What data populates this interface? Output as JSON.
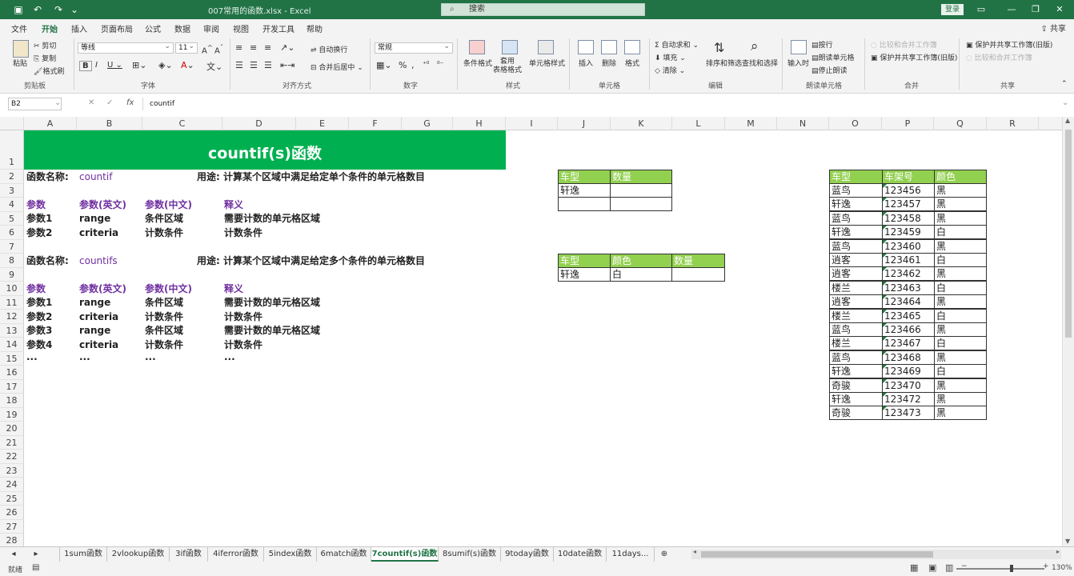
{
  "window": {
    "title": "007常用的函数.xlsx  -  Excel",
    "search_placeholder": "搜索",
    "login": "登录"
  },
  "menu": [
    "文件",
    "开始",
    "插入",
    "页面布局",
    "公式",
    "数据",
    "审阅",
    "视图",
    "开发工具",
    "帮助"
  ],
  "share": "共享",
  "ribbon": {
    "clipboard": {
      "paste": "粘贴",
      "cut": "剪切",
      "copy": "复制",
      "format_painter": "格式刷",
      "label": "剪贴板"
    },
    "font": {
      "name": "等线",
      "size": "11",
      "label": "字体"
    },
    "alignment": {
      "wrap": "自动换行",
      "merge": "合并后居中",
      "label": "对齐方式"
    },
    "number": {
      "format": "常规",
      "label": "数字"
    },
    "styles": {
      "conditional": "条件格式",
      "table1": "套用",
      "table2": "表格格式",
      "cell_styles": "单元格样式",
      "label": "样式"
    },
    "cells": {
      "insert": "插入",
      "delete": "删除",
      "format": "格式",
      "label": "单元格"
    },
    "editing": {
      "autosum": "自动求和",
      "fill": "填充",
      "clear": "清除",
      "sort": "排序和筛选",
      "find": "查找和选择",
      "label": "编辑"
    },
    "read": {
      "input": "输入时",
      "row": "按行",
      "read_cell": "朗读单元格",
      "stop": "停止朗读",
      "label": "朗读单元格"
    },
    "merge_grp": {
      "compare": "比较和合并工作簿",
      "protect_share": "保护并共享工作簿(旧版)",
      "label": "合并"
    },
    "share_grp": {
      "protect": "保护并共享工作簿(旧版)",
      "compare": "比较和合并工作簿",
      "label": "共享"
    }
  },
  "formula_bar": {
    "name_box": "B2",
    "fx": "fx",
    "formula": "countif"
  },
  "columns": [
    "A",
    "B",
    "C",
    "D",
    "E",
    "F",
    "G",
    "H",
    "I",
    "J",
    "K",
    "L",
    "M",
    "N",
    "O",
    "P",
    "Q",
    "R"
  ],
  "rows": [
    "1",
    "2",
    "3",
    "4",
    "5",
    "6",
    "7",
    "8",
    "9",
    "10",
    "11",
    "12",
    "13",
    "14",
    "15",
    "16",
    "17",
    "18",
    "19",
    "20",
    "21",
    "22",
    "23",
    "24",
    "25",
    "26",
    "27",
    "28"
  ],
  "banner": "countif(s)函数",
  "left_cells": {
    "r2": {
      "name_lbl": "函数名称:",
      "name": "countif",
      "usage": "用途: 计算某个区域中满足给定单个条件的单元格数目"
    },
    "r4": {
      "a": "参数",
      "b": "参数(英文)",
      "c": "参数(中文)",
      "d": "释义"
    },
    "r5": {
      "a": "参数1",
      "b": "range",
      "c": "条件区域",
      "d": "需要计数的单元格区域"
    },
    "r6": {
      "a": "参数2",
      "b": "criteria",
      "c": "计数条件",
      "d": "计数条件"
    },
    "r8": {
      "name_lbl": "函数名称:",
      "name": "countifs",
      "usage": "用途: 计算某个区域中满足给定多个条件的单元格数目"
    },
    "r10": {
      "a": "参数",
      "b": "参数(英文)",
      "c": "参数(中文)",
      "d": "释义"
    },
    "r11": {
      "a": "参数1",
      "b": "range",
      "c": "条件区域",
      "d": "需要计数的单元格区域"
    },
    "r12": {
      "a": "参数2",
      "b": "criteria",
      "c": "计数条件",
      "d": "计数条件"
    },
    "r13": {
      "a": "参数3",
      "b": "range",
      "c": "条件区域",
      "d": "需要计数的单元格区域"
    },
    "r14": {
      "a": "参数4",
      "b": "criteria",
      "c": "计数条件",
      "d": "计数条件"
    },
    "r15": {
      "a": "...",
      "b": "...",
      "c": "...",
      "d": "..."
    }
  },
  "table1": {
    "headers": [
      "车型",
      "数量"
    ],
    "rows": [
      [
        "轩逸",
        ""
      ],
      [
        "",
        ""
      ]
    ]
  },
  "table2": {
    "headers": [
      "车型",
      "颜色",
      "数量"
    ],
    "rows": [
      [
        "轩逸",
        "白",
        ""
      ]
    ]
  },
  "table3": {
    "headers": [
      "车型",
      "车架号",
      "颜色"
    ],
    "rows": [
      [
        "蓝鸟",
        "123456",
        "黑"
      ],
      [
        "轩逸",
        "123457",
        "黑"
      ],
      [
        "蓝鸟",
        "123458",
        "黑"
      ],
      [
        "轩逸",
        "123459",
        "白"
      ],
      [
        "蓝鸟",
        "123460",
        "黑"
      ],
      [
        "逍客",
        "123461",
        "白"
      ],
      [
        "逍客",
        "123462",
        "黑"
      ],
      [
        "楼兰",
        "123463",
        "白"
      ],
      [
        "逍客",
        "123464",
        "黑"
      ],
      [
        "楼兰",
        "123465",
        "白"
      ],
      [
        "蓝鸟",
        "123466",
        "黑"
      ],
      [
        "楼兰",
        "123467",
        "白"
      ],
      [
        "蓝鸟",
        "123468",
        "黑"
      ],
      [
        "轩逸",
        "123469",
        "白"
      ],
      [
        "奇骏",
        "123470",
        "黑"
      ],
      [
        "轩逸",
        "123472",
        "黑"
      ],
      [
        "奇骏",
        "123473",
        "黑"
      ]
    ]
  },
  "tabs": [
    "1sum函数",
    "2vlookup函数",
    "3if函数",
    "4iferror函数",
    "5index函数",
    "6match函数",
    "7countif(s)函数",
    "8sumif(s)函数",
    "9today函数",
    "10date函数",
    "11days..."
  ],
  "active_tab": 6,
  "status": {
    "ready": "就绪",
    "zoom": "130%"
  },
  "colors": {
    "excel_green": "#217346",
    "banner": "#00b050",
    "header_green": "#92d050",
    "purple": "#7030a0"
  }
}
